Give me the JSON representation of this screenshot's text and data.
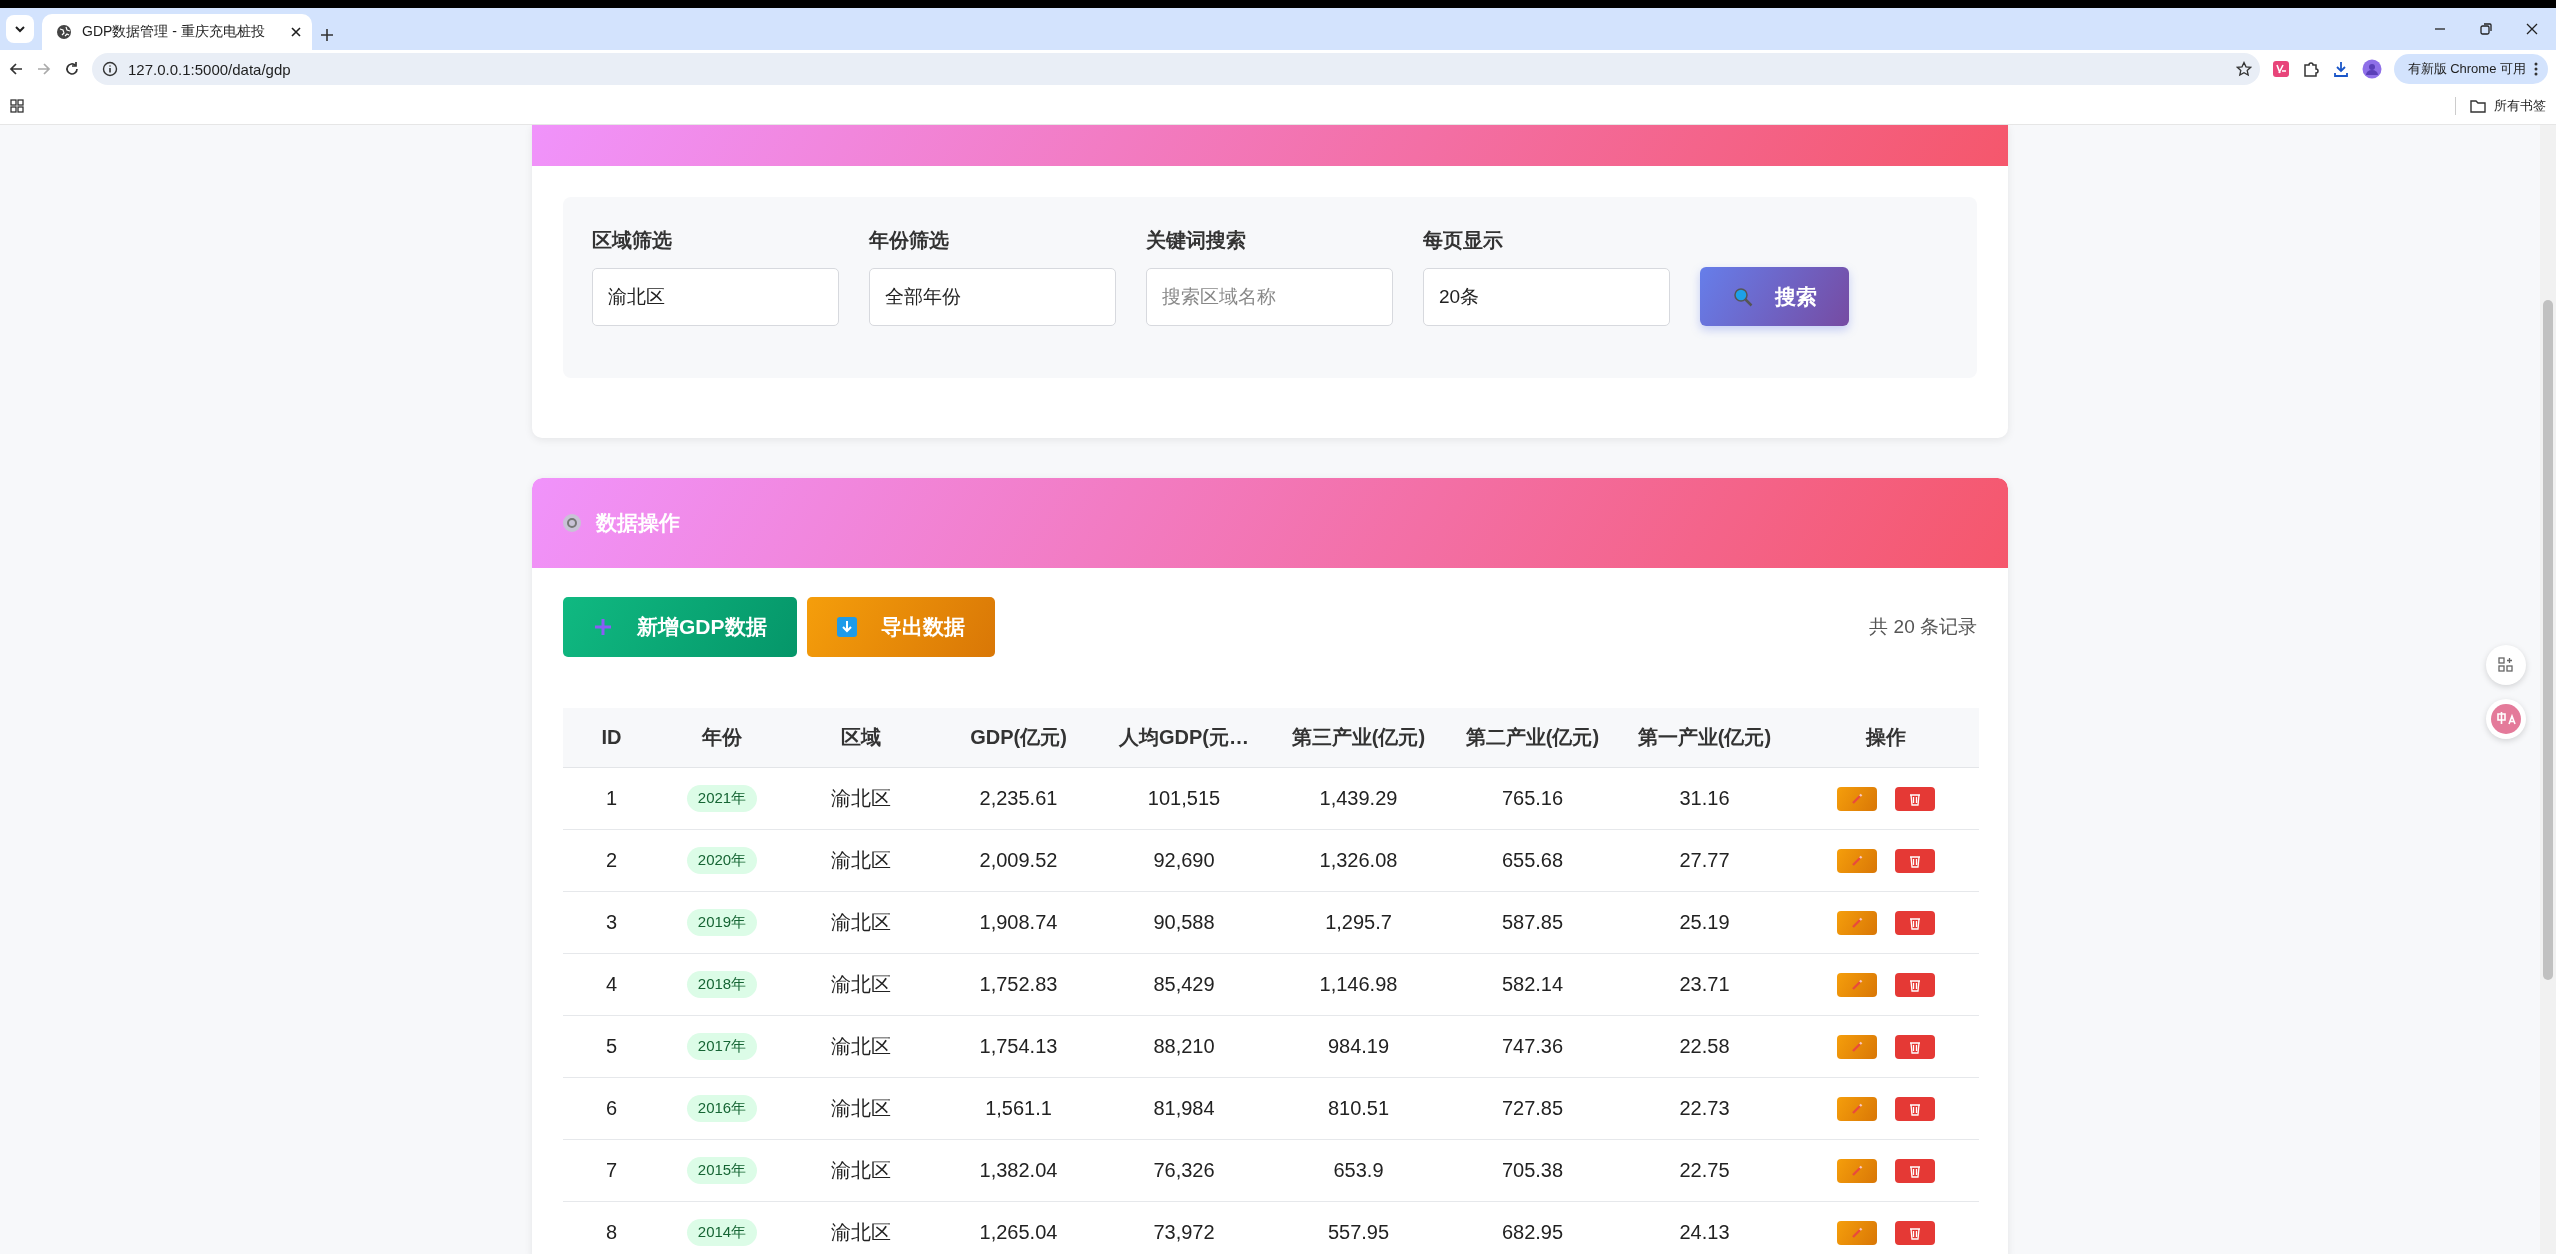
{
  "browser": {
    "tab_title": "GDP数据管理 - 重庆充电桩投",
    "url": "127.0.0.1:5000/data/gdp",
    "update_button": "有新版 Chrome 可用",
    "bookmarks_folder": "所有书签"
  },
  "filter": {
    "fields": [
      {
        "label": "区域筛选",
        "value": "渝北区"
      },
      {
        "label": "年份筛选",
        "value": "全部年份"
      },
      {
        "label": "关键词搜索",
        "placeholder": "搜索区域名称"
      },
      {
        "label": "每页显示",
        "value": "20条"
      }
    ],
    "search_button": "搜索"
  },
  "operations": {
    "title": "数据操作",
    "buttons": [
      {
        "label": "新增GDP数据",
        "kind": "add"
      },
      {
        "label": "导出数据",
        "kind": "export"
      }
    ],
    "record_count": "共 20 条记录"
  },
  "table": {
    "columns": [
      "ID",
      "年份",
      "区域",
      "GDP(亿元)",
      "人均GDP(元…",
      "第三产业(亿元)",
      "第二产业(亿元)",
      "第一产业(亿元)",
      "操作"
    ],
    "rows": [
      [
        "1",
        "2021年",
        "渝北区",
        "2,235.61",
        "101,515",
        "1,439.29",
        "765.16",
        "31.16"
      ],
      [
        "2",
        "2020年",
        "渝北区",
        "2,009.52",
        "92,690",
        "1,326.08",
        "655.68",
        "27.77"
      ],
      [
        "3",
        "2019年",
        "渝北区",
        "1,908.74",
        "90,588",
        "1,295.7",
        "587.85",
        "25.19"
      ],
      [
        "4",
        "2018年",
        "渝北区",
        "1,752.83",
        "85,429",
        "1,146.98",
        "582.14",
        "23.71"
      ],
      [
        "5",
        "2017年",
        "渝北区",
        "1,754.13",
        "88,210",
        "984.19",
        "747.36",
        "22.58"
      ],
      [
        "6",
        "2016年",
        "渝北区",
        "1,561.1",
        "81,984",
        "810.51",
        "727.85",
        "22.73"
      ],
      [
        "7",
        "2015年",
        "渝北区",
        "1,382.04",
        "76,326",
        "653.9",
        "705.38",
        "22.75"
      ],
      [
        "8",
        "2014年",
        "渝北区",
        "1,265.04",
        "73,972",
        "557.95",
        "682.95",
        "24.13"
      ]
    ]
  }
}
